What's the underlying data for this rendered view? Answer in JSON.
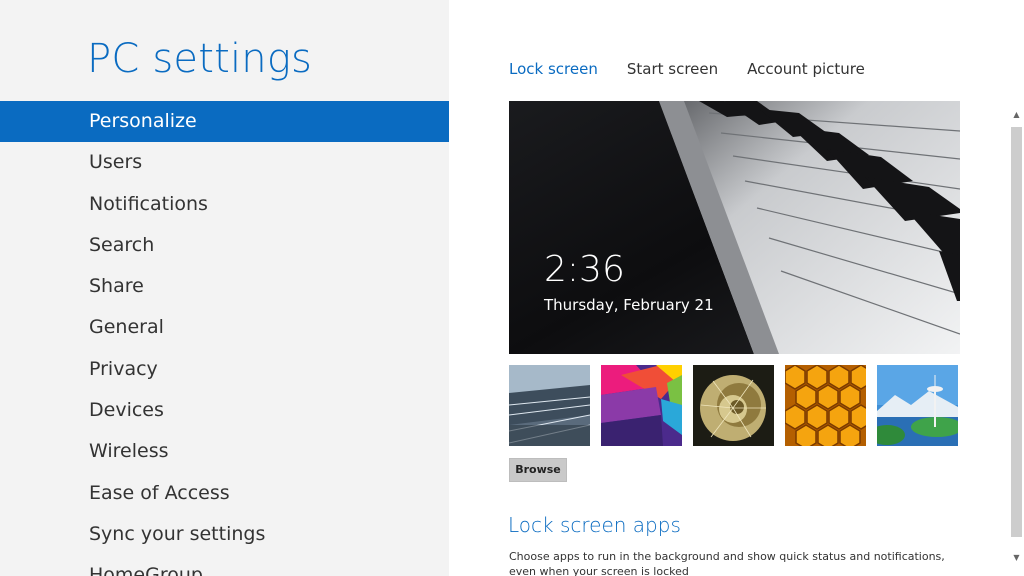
{
  "app": {
    "title": "PC settings"
  },
  "sidebar": {
    "items": [
      {
        "label": "Personalize",
        "selected": true
      },
      {
        "label": "Users"
      },
      {
        "label": "Notifications"
      },
      {
        "label": "Search"
      },
      {
        "label": "Share"
      },
      {
        "label": "General"
      },
      {
        "label": "Privacy"
      },
      {
        "label": "Devices"
      },
      {
        "label": "Wireless"
      },
      {
        "label": "Ease of Access"
      },
      {
        "label": "Sync your settings"
      },
      {
        "label": "HomeGroup"
      }
    ]
  },
  "main": {
    "tabs": [
      {
        "label": "Lock screen",
        "active": true
      },
      {
        "label": "Start screen"
      },
      {
        "label": "Account picture"
      }
    ],
    "preview": {
      "time": "2:36",
      "date": "Thursday, February 21",
      "image": "piano-keys"
    },
    "thumbnails": [
      "tunnel-lights",
      "colorful-geometric",
      "nautilus-shell",
      "honeycomb",
      "seattle-space-needle"
    ],
    "browse_label": "Browse",
    "lock_screen_apps": {
      "title": "Lock screen apps",
      "description": "Choose apps to run in the background and show quick status and notifications, even when your screen is locked"
    }
  },
  "colors": {
    "accent": "#0a6bc1",
    "sidebar_bg": "#f3f3f3",
    "content_bg": "#ffffff",
    "browse_bg": "#c9c9c9"
  },
  "icons": {
    "scroll_up": "▲",
    "scroll_down": "▼"
  }
}
